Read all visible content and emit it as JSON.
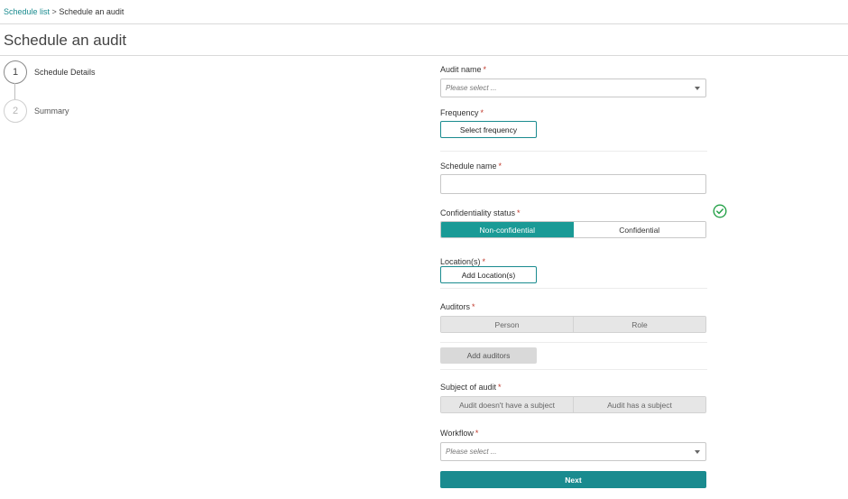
{
  "breadcrumb": {
    "link": "Schedule list",
    "separator": ">",
    "current": "Schedule an audit"
  },
  "page_title": "Schedule an audit",
  "steps": [
    {
      "number": "1",
      "label": "Schedule Details",
      "state": "active"
    },
    {
      "number": "2",
      "label": "Summary",
      "state": "inactive"
    }
  ],
  "form": {
    "audit_name": {
      "label": "Audit name",
      "required": "*",
      "placeholder": "Please select ..."
    },
    "frequency": {
      "label": "Frequency",
      "required": "*",
      "button": "Select frequency"
    },
    "schedule_name": {
      "label": "Schedule name",
      "required": "*",
      "value": ""
    },
    "confidentiality": {
      "label": "Confidentiality status",
      "required": "*",
      "options": [
        "Non-confidential",
        "Confidential"
      ],
      "selected": "Non-confidential",
      "valid_icon": "check-circle-icon"
    },
    "locations": {
      "label": "Location(s)",
      "required": "*",
      "button": "Add Location(s)"
    },
    "auditors": {
      "label": "Auditors",
      "required": "*",
      "options": [
        "Person",
        "Role"
      ],
      "add_button": "Add auditors"
    },
    "subject": {
      "label": "Subject of audit",
      "required": "*",
      "options": [
        "Audit doesn't have a subject",
        "Audit has a subject"
      ]
    },
    "workflow": {
      "label": "Workflow",
      "required": "*",
      "placeholder": "Please select ..."
    },
    "next_button": "Next"
  },
  "colors": {
    "accent": "#1a8b8f",
    "active_segment": "#1a9a96",
    "required": "#c0392b",
    "valid": "#27a24a"
  }
}
